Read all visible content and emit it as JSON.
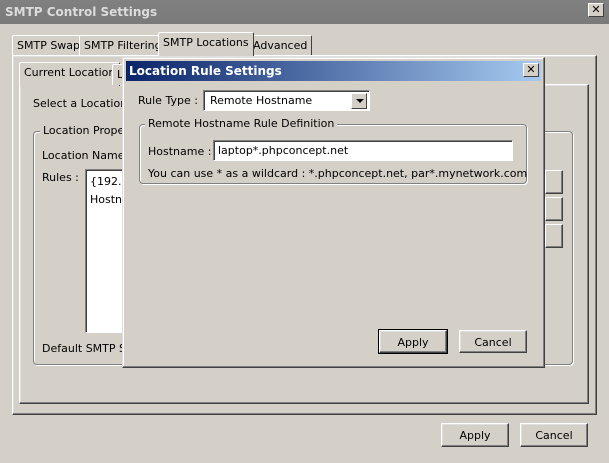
{
  "window": {
    "title": "SMTP Control Settings",
    "close_glyph": "✕"
  },
  "main_tabs": [
    {
      "label": "SMTP Swap"
    },
    {
      "label": "SMTP Filtering"
    },
    {
      "label": "SMTP Locations"
    },
    {
      "label": "Advanced"
    }
  ],
  "sub_tabs": [
    {
      "label": "Current Location"
    },
    {
      "label": "L"
    }
  ],
  "locations": {
    "select_label": "Select a Location :",
    "properties_caption": "Location Propert",
    "name_label": "Location Name :",
    "rules_label": "Rules :",
    "rules": [
      "{192.1",
      "Hostna"
    ],
    "default_smtp_label": "Default SMTP Se"
  },
  "dialog": {
    "title": "Location Rule Settings",
    "close_glyph": "✕",
    "rule_type_label": "Rule Type :",
    "rule_type_value": "Remote Hostname",
    "group_caption": "Remote Hostname Rule Definition",
    "hostname_label": "Hostname :",
    "hostname_value": "laptop*.phpconcept.net",
    "hint": "You can use * as a wildcard : *.phpconcept.net, par*.mynetwork.com",
    "apply_label": "Apply",
    "cancel_label": "Cancel"
  },
  "footer": {
    "apply_label": "Apply",
    "cancel_label": "Cancel"
  },
  "colors": {
    "dialog_title_start": "#0a246a",
    "dialog_title_end": "#a6caf0",
    "face": "#d4d0c8"
  }
}
